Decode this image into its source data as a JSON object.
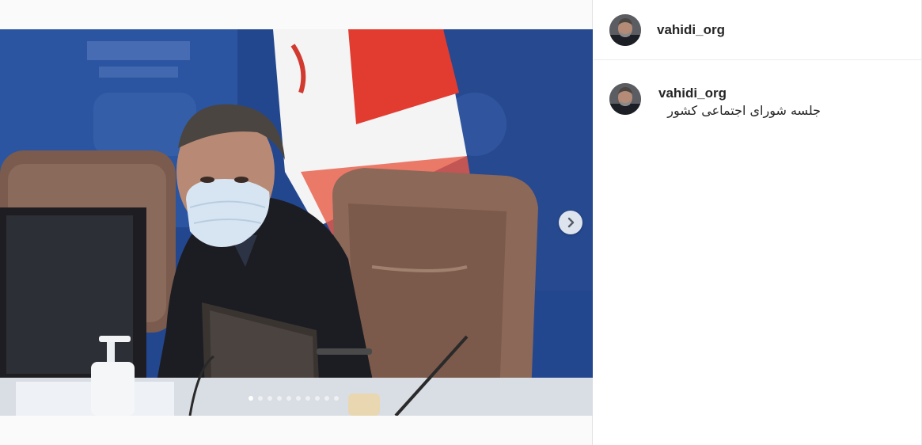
{
  "post": {
    "author": {
      "username": "vahidi_org"
    },
    "caption": {
      "username": "vahidi_org",
      "text": "جلسه شورای اجتماعی کشور"
    }
  },
  "carousel": {
    "total_slides": 10,
    "current_slide": 1,
    "next_icon": "chevron-right-icon"
  },
  "colors": {
    "username": "#262626",
    "divider": "#ececec",
    "backdrop": "#1f3f86",
    "media_background": "#fafafa"
  }
}
